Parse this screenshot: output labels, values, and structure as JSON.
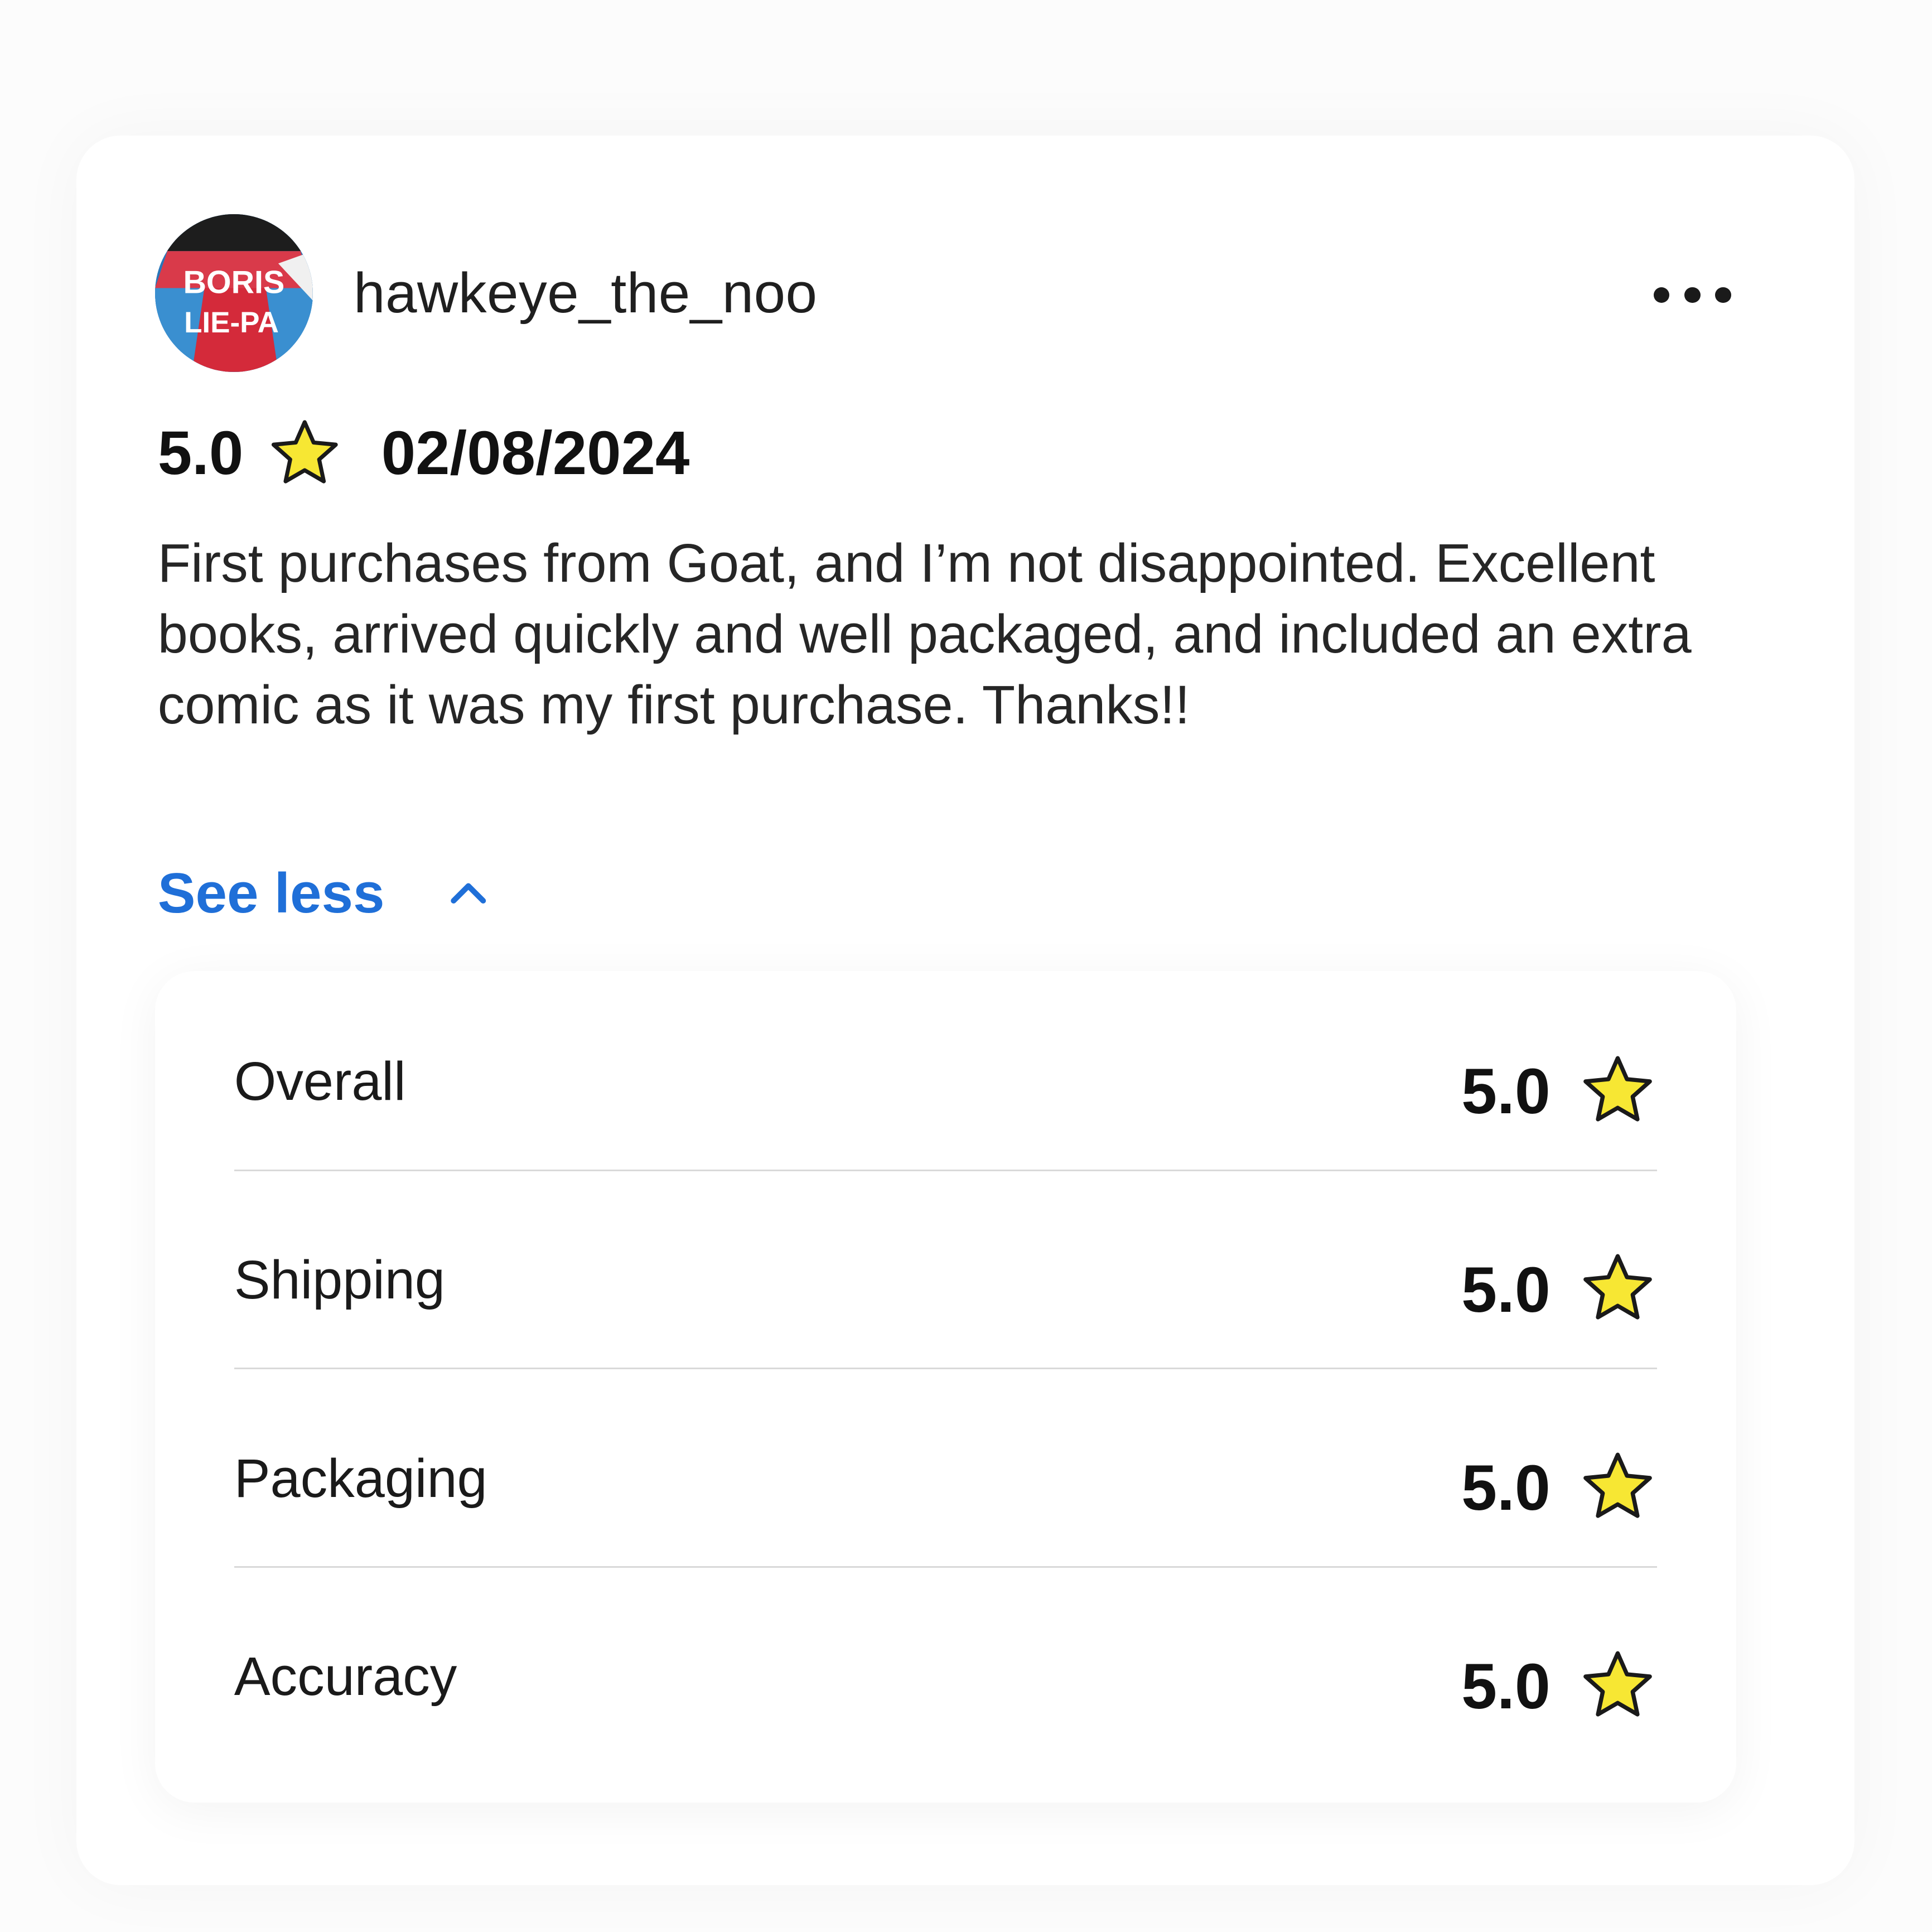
{
  "review": {
    "username": "hawkeye_the_noo",
    "avatar_text_line1": "BORIS",
    "avatar_text_line2": "LIE-PA",
    "rating": "5.0",
    "date": "02/08/2024",
    "text": "First purchases from Goat, and I’m not disappointed. Excellent books, arrived quickly and well packaged, and included an extra comic as it was my first purchase. Thanks!!",
    "toggle_label": "See less"
  },
  "ratings": [
    {
      "label": "Overall",
      "value": "5.0"
    },
    {
      "label": "Shipping",
      "value": "5.0"
    },
    {
      "label": "Packaging",
      "value": "5.0"
    },
    {
      "label": "Accuracy",
      "value": "5.0"
    }
  ],
  "icons": {
    "more": "more-horizontal-icon",
    "star": "star-icon",
    "chevron": "chevron-up-icon"
  },
  "colors": {
    "accent": "#1f6fd8",
    "star_fill": "#f7e733",
    "star_stroke": "#1a1a1a"
  }
}
